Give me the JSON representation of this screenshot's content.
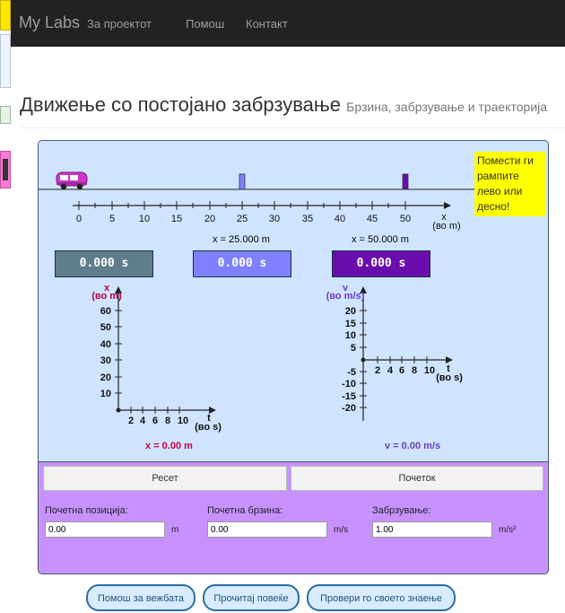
{
  "navbar": {
    "brand": "My Labs",
    "links": [
      "За проектот",
      "Помош",
      "Контакт"
    ]
  },
  "page": {
    "title": "Движење со постојано забрзување",
    "subtitle": "Брзина, забрзување и траекторија"
  },
  "sim": {
    "hint": "Помести ги рампите лево или десно!",
    "track": {
      "ticks": [
        "0",
        "5",
        "10",
        "15",
        "20",
        "25",
        "30",
        "35",
        "40",
        "45",
        "50"
      ],
      "axis_label": "x",
      "axis_unit": "(во m)"
    },
    "timers": [
      {
        "label": "",
        "value": "0.000 s",
        "color": "#607d8b"
      },
      {
        "label": "x = 25.000 m",
        "value": "0.000 s",
        "color": "#8080ff"
      },
      {
        "label": "x = 50.000 m",
        "value": "0.000 s",
        "color": "#6a0dad"
      }
    ],
    "graph_x": {
      "y_label": "x",
      "y_unit": "(во m)",
      "y_ticks": [
        "60",
        "50",
        "40",
        "30",
        "20",
        "10"
      ],
      "x_ticks": [
        "2",
        "4",
        "6",
        "8",
        "10"
      ],
      "x_label": "t",
      "x_unit": "(во s)",
      "readout": "x = 0.00 m"
    },
    "graph_v": {
      "y_label": "v",
      "y_unit": "(во m/s)",
      "y_ticks_pos": [
        "20",
        "15",
        "10",
        "5"
      ],
      "y_ticks_neg": [
        "-5",
        "-10",
        "-15",
        "-20"
      ],
      "x_ticks": [
        "2",
        "4",
        "6",
        "8",
        "10"
      ],
      "x_label": "t",
      "x_unit": "(во s)",
      "readout": "v = 0.00 m/s"
    }
  },
  "controls": {
    "reset_label": "Ресет",
    "start_label": "Почеток",
    "fields": [
      {
        "label": "Почетна позиција:",
        "value": "0.00",
        "unit": "m"
      },
      {
        "label": "Почетна брзина:",
        "value": "0.00",
        "unit": "m/s"
      },
      {
        "label": "Забрзување:",
        "value": "1.00",
        "unit": "m/s²"
      }
    ]
  },
  "footer": {
    "buttons": [
      "Помош за вежбата",
      "Прочитај повеќе",
      "Провери го своето знаење"
    ]
  },
  "colors": {
    "accent_purple": "#c792ff",
    "sim_bg": "#cfe4ff",
    "hint_yellow": "#ffff00"
  }
}
